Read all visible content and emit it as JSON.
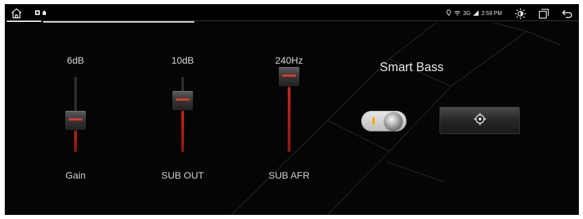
{
  "status_bar": {
    "home_icon": "home-icon",
    "notification_icons": [
      "notification-icon",
      "android-icon"
    ],
    "system": {
      "location_icon": "location-icon",
      "wifi_icon": "wifi-icon",
      "network": "3G",
      "signal_icon": "signal-icon",
      "time": "2:59 PM"
    },
    "nav_icons": [
      "brightness-icon",
      "recent-apps-icon",
      "back-icon"
    ]
  },
  "sliders": [
    {
      "value": "6dB",
      "label": "Gain",
      "level": 0.42
    },
    {
      "value": "10dB",
      "label": "SUB OUT",
      "level": 0.68
    },
    {
      "value": "240Hz",
      "label": "SUB AFR",
      "level": 1.0
    }
  ],
  "smart_bass": {
    "title": "Smart Bass",
    "enabled": false,
    "target_icon": "target-icon"
  },
  "colors": {
    "accent_red": "#d22a1f",
    "toggle_lamp": "#f2b01c",
    "background": "#050505"
  }
}
